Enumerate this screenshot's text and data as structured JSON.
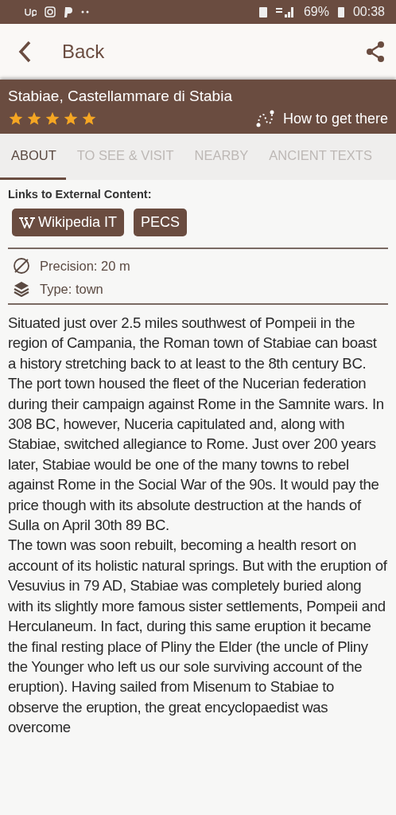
{
  "status_bar": {
    "battery": "69%",
    "time": "00:38"
  },
  "toolbar": {
    "back_label": "Back"
  },
  "header": {
    "title": "Stabiae, Castellammare di Stabia",
    "stars": 5,
    "directions": "How to get there"
  },
  "tabs": [
    {
      "label": "ABOUT",
      "selected": true
    },
    {
      "label": "TO SEE & VISIT",
      "selected": false
    },
    {
      "label": "NEARBY",
      "selected": false
    },
    {
      "label": "ANCIENT TEXTS",
      "selected": false
    }
  ],
  "links": {
    "heading": "Links to External Content:",
    "buttons": [
      {
        "kind": "wikipedia",
        "label": "Wikipedia IT"
      },
      {
        "kind": "plain",
        "label": "PECS"
      }
    ]
  },
  "info": [
    {
      "kind": "precision",
      "text": "Precision: 20 m"
    },
    {
      "kind": "type",
      "text": "Type: town"
    }
  ],
  "body": [
    "Situated just over 2.5 miles southwest of Pompeii in the region of Campania, the Roman town of Stabiae can boast a history stretching back to at least to the 8th century BC. The port town housed the fleet of the Nucerian federation during their campaign against Rome in the Samnite wars. In 308 BC, however, Nuceria capitulated and, along with Stabiae, switched allegiance to Rome. Just over 200 years later, Stabiae would be one of the many towns to rebel against Rome in the Social War of the 90s. It would pay the price though with its absolute destruction at the hands of Sulla on April 30th 89 BC.",
    "The town was soon rebuilt, becoming a health resort on account of its holistic natural springs. But with the eruption of Vesuvius in 79 AD, Stabiae was completely buried along with its slightly more famous sister settlements, Pompeii and Herculaneum. In fact, during this same eruption it became the final resting place of Pliny the Elder (the uncle of Pliny the Younger who left us our sole surviving account of the eruption). Having sailed from Misenum to Stabiae to observe the eruption, the great encyclopaedist was overcome"
  ]
}
